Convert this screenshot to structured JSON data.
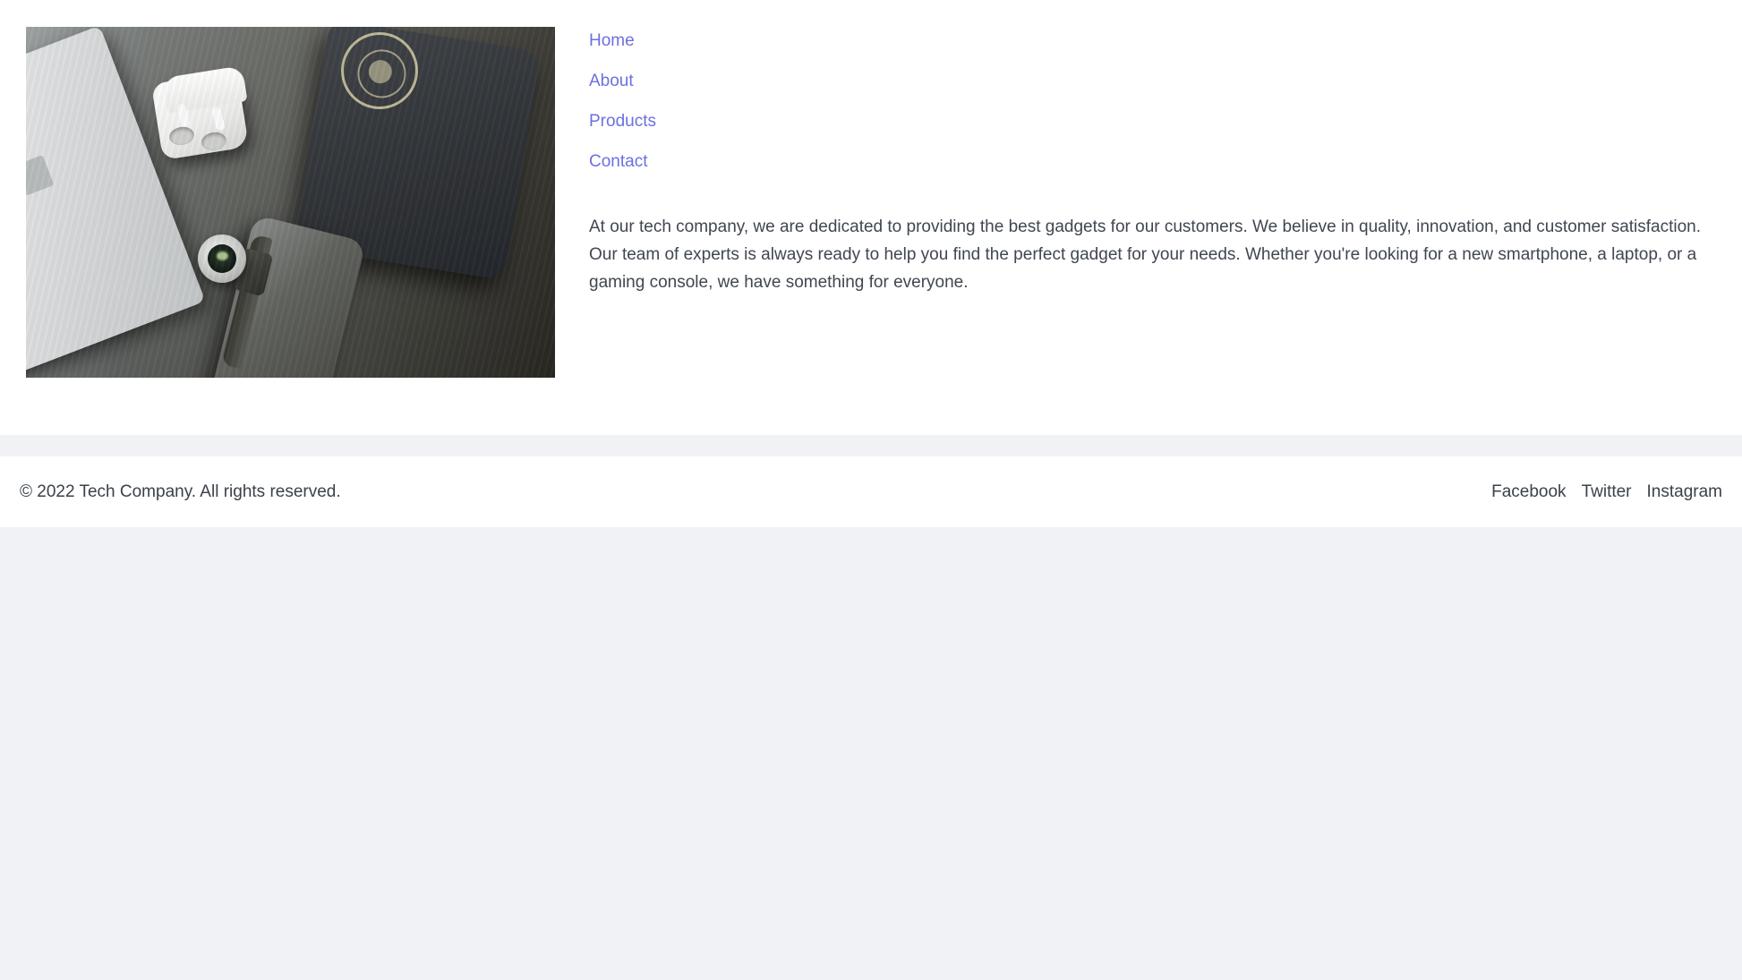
{
  "theme": {
    "page_background": "#f1f2f6",
    "card_background": "#ffffff",
    "link_color": "#6c70e0",
    "text_color": "#404651"
  },
  "hero": {
    "image": {
      "alt": "Tech gadgets on a desk: laptop, earbuds case, smartphone with lens, tablet",
      "icon": "photo-icon"
    },
    "nav": {
      "items": [
        {
          "label": "Home",
          "name": "nav-link-home"
        },
        {
          "label": "About",
          "name": "nav-link-about"
        },
        {
          "label": "Products",
          "name": "nav-link-products"
        },
        {
          "label": "Contact",
          "name": "nav-link-contact"
        }
      ]
    },
    "intro": "At our tech company, we are dedicated to providing the best gadgets for our customers. We believe in quality, innovation, and customer satisfaction. Our team of experts is always ready to help you find the perfect gadget for your needs. Whether you're looking for a new smartphone, a laptop, or a gaming console, we have something for everyone."
  },
  "footer": {
    "copyright": "© 2022 Tech Company. All rights reserved.",
    "social": [
      {
        "label": "Facebook",
        "name": "social-link-facebook"
      },
      {
        "label": "Twitter",
        "name": "social-link-twitter"
      },
      {
        "label": "Instagram",
        "name": "social-link-instagram"
      }
    ]
  }
}
